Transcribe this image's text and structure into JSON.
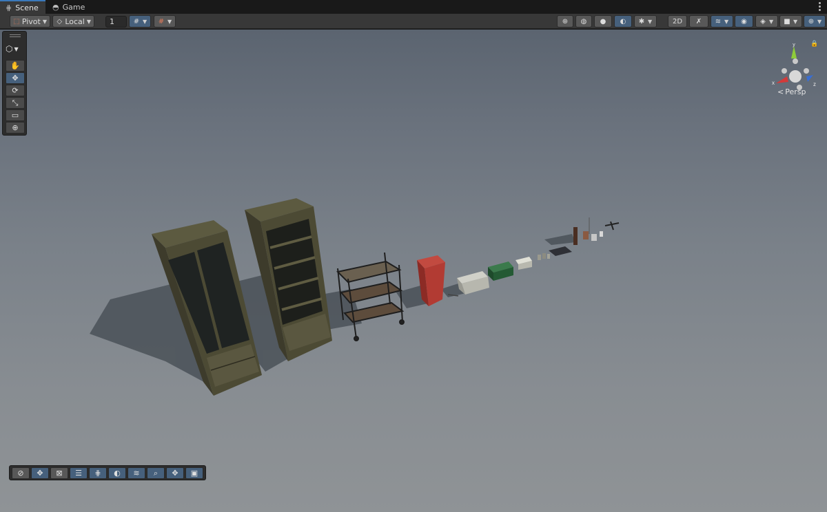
{
  "tabs": [
    {
      "label": "Scene",
      "icon": "grid-icon",
      "active": true
    },
    {
      "label": "Game",
      "icon": "gamepad-icon",
      "active": false
    }
  ],
  "toolbar": {
    "pivot_label": "Pivot",
    "local_label": "Local",
    "grid_size_value": "1"
  },
  "viewport": {
    "projection_label": "Persp",
    "gizmo_axes": {
      "x": "x",
      "y": "y",
      "z": "z"
    }
  },
  "colors": {
    "accent": "#46607c",
    "tab_highlight": "#3a79bb",
    "axis_x": "#d33a3a",
    "axis_y": "#8ecb3a",
    "axis_z": "#3a6ed3"
  }
}
